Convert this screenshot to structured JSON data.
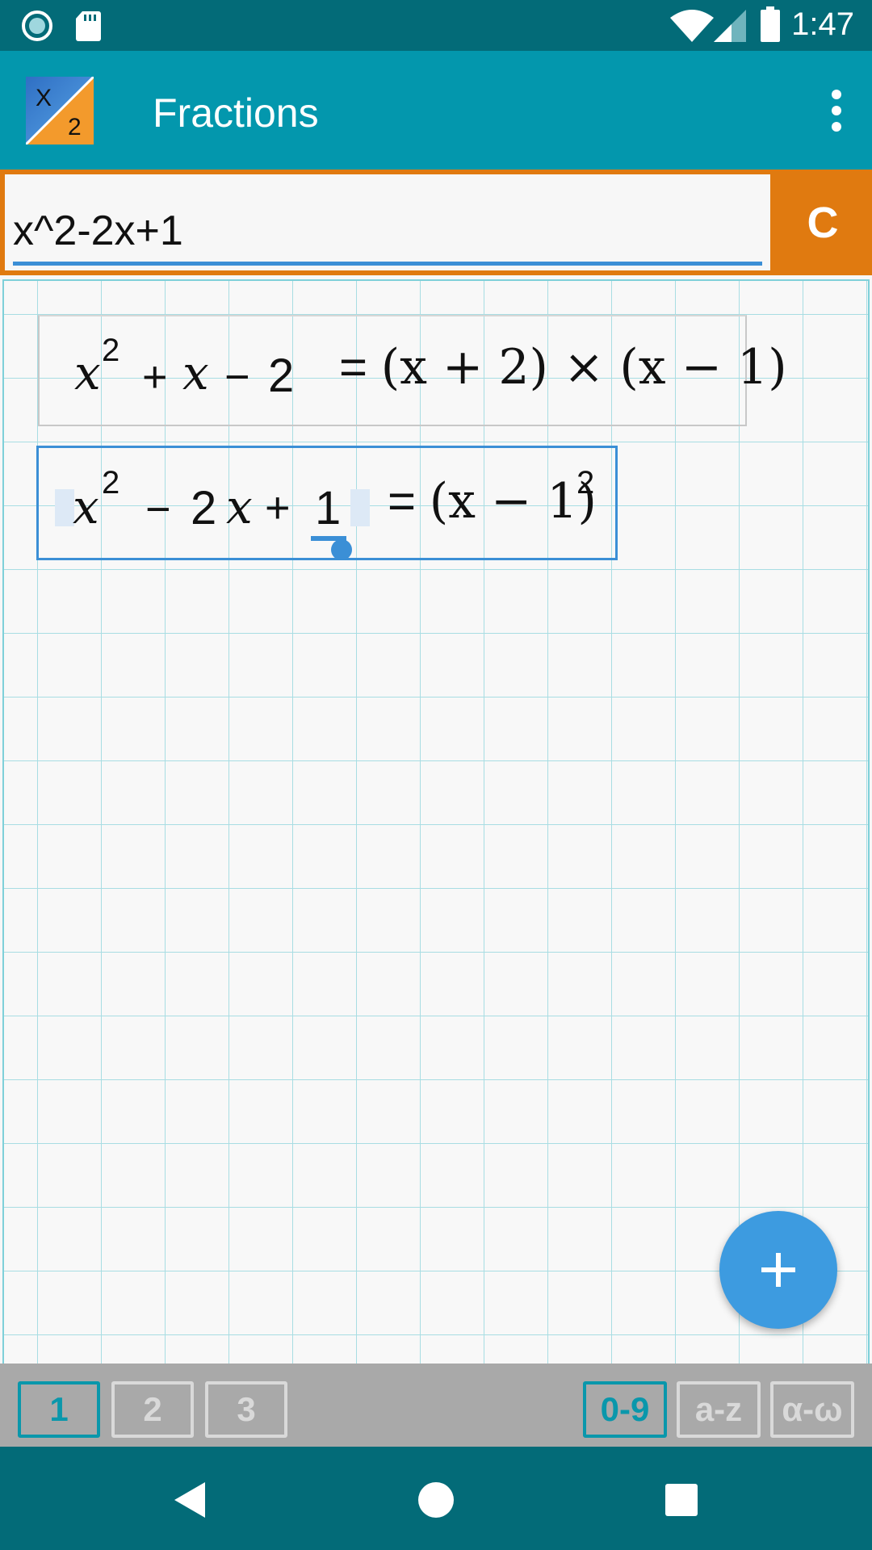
{
  "status_bar": {
    "time": "1:47",
    "icons": [
      "record-icon",
      "sd-card-icon",
      "wifi-icon",
      "signal-icon",
      "battery-icon"
    ]
  },
  "app_bar": {
    "title": "Fractions",
    "logo": {
      "top": "X",
      "bottom": "2"
    },
    "menu_icon": "more-vert-icon"
  },
  "input": {
    "value": "x^2-2x+1",
    "clear_label": "C"
  },
  "expressions": [
    {
      "lhs": [
        "x",
        "2",
        "+",
        "x",
        "−",
        "2"
      ],
      "rhs": "(x + 2) × (x − 1)"
    },
    {
      "lhs": [
        "x",
        "2",
        "−",
        "2",
        "x",
        "+",
        "1"
      ],
      "rhs": "(x − 1)",
      "rhs_exp": "2"
    }
  ],
  "keyboard_tabs": {
    "left": [
      {
        "label": "1",
        "active": true
      },
      {
        "label": "2",
        "active": false
      },
      {
        "label": "3",
        "active": false
      }
    ],
    "right": [
      {
        "label": "0-9",
        "active": true
      },
      {
        "label": "a-z",
        "active": false
      },
      {
        "label": "α-ω",
        "active": false
      }
    ]
  },
  "fab_icon": "plus-icon",
  "nav": [
    "back-icon",
    "home-icon",
    "recents-icon"
  ],
  "colors": {
    "status_bar": "#036b78",
    "app_bar": "#0397ad",
    "accent_orange": "#e07a10",
    "accent_blue": "#3b8fd6",
    "grid_line": "#a8dde3"
  }
}
